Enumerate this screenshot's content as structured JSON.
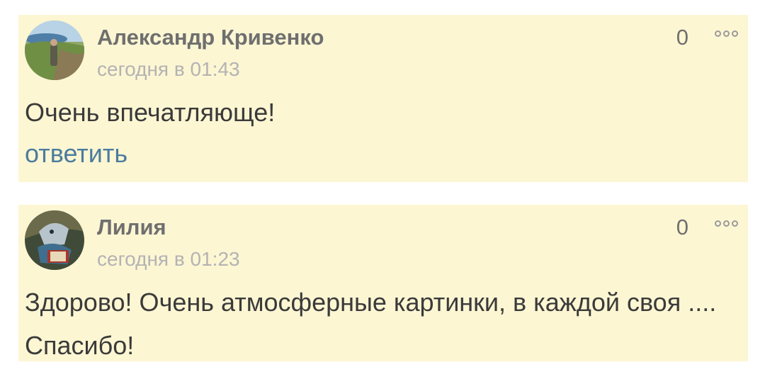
{
  "comments": [
    {
      "author": "Александр Кривенко",
      "time": "сегодня в 01:43",
      "score": "0",
      "text": "Очень впечатляюще!",
      "reply_label": "ответить"
    },
    {
      "author": "Лилия",
      "time": "сегодня в 01:23",
      "score": "0",
      "text": "Здорово! Очень атмосферные картинки, в каждой своя .... Спасибо!"
    }
  ],
  "icons": {
    "more": "more-options-icon"
  },
  "colors": {
    "comment_bg": "#fdf6d3",
    "author": "#6f6f6f",
    "time": "#b3b3b3",
    "text": "#3a3a3a",
    "link": "#4b7c9e"
  }
}
